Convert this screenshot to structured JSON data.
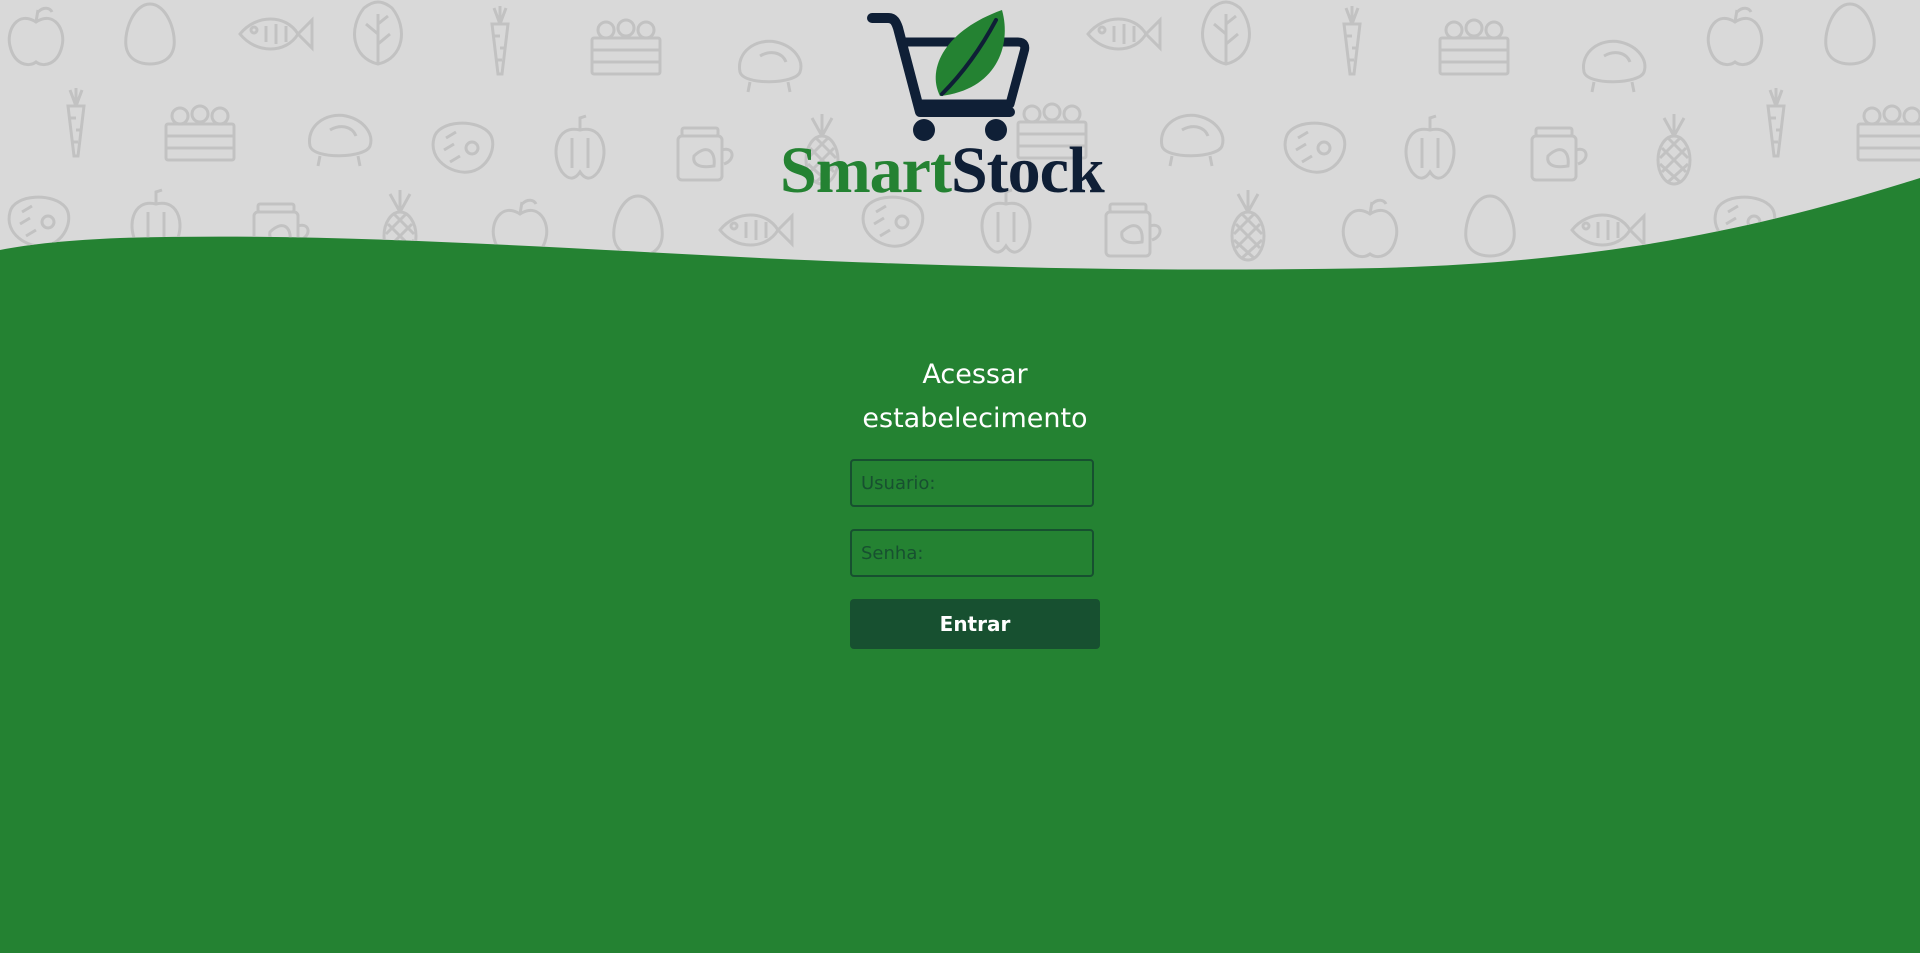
{
  "brand": {
    "name_part1": "Smart",
    "name_part2": "Stock",
    "color_green": "#248232",
    "color_navy": "#0f1f36"
  },
  "login": {
    "title_line1": "Acessar",
    "title_line2": "estabelecimento",
    "username_placeholder": "Usuario:",
    "password_placeholder": "Senha:",
    "submit_label": "Entrar"
  },
  "colors": {
    "background_green": "#248232",
    "header_gray": "#d9d9d9",
    "pattern_gray": "#c2c2c2",
    "button_dark_green": "#175030"
  },
  "background_pattern_icons": [
    "apple-icon",
    "egg-icon",
    "fish-icon",
    "lettuce-icon",
    "carrot-icon",
    "crate-icon",
    "chicken-icon",
    "steak-icon",
    "pepper-icon",
    "jar-icon",
    "pineapple-icon"
  ]
}
